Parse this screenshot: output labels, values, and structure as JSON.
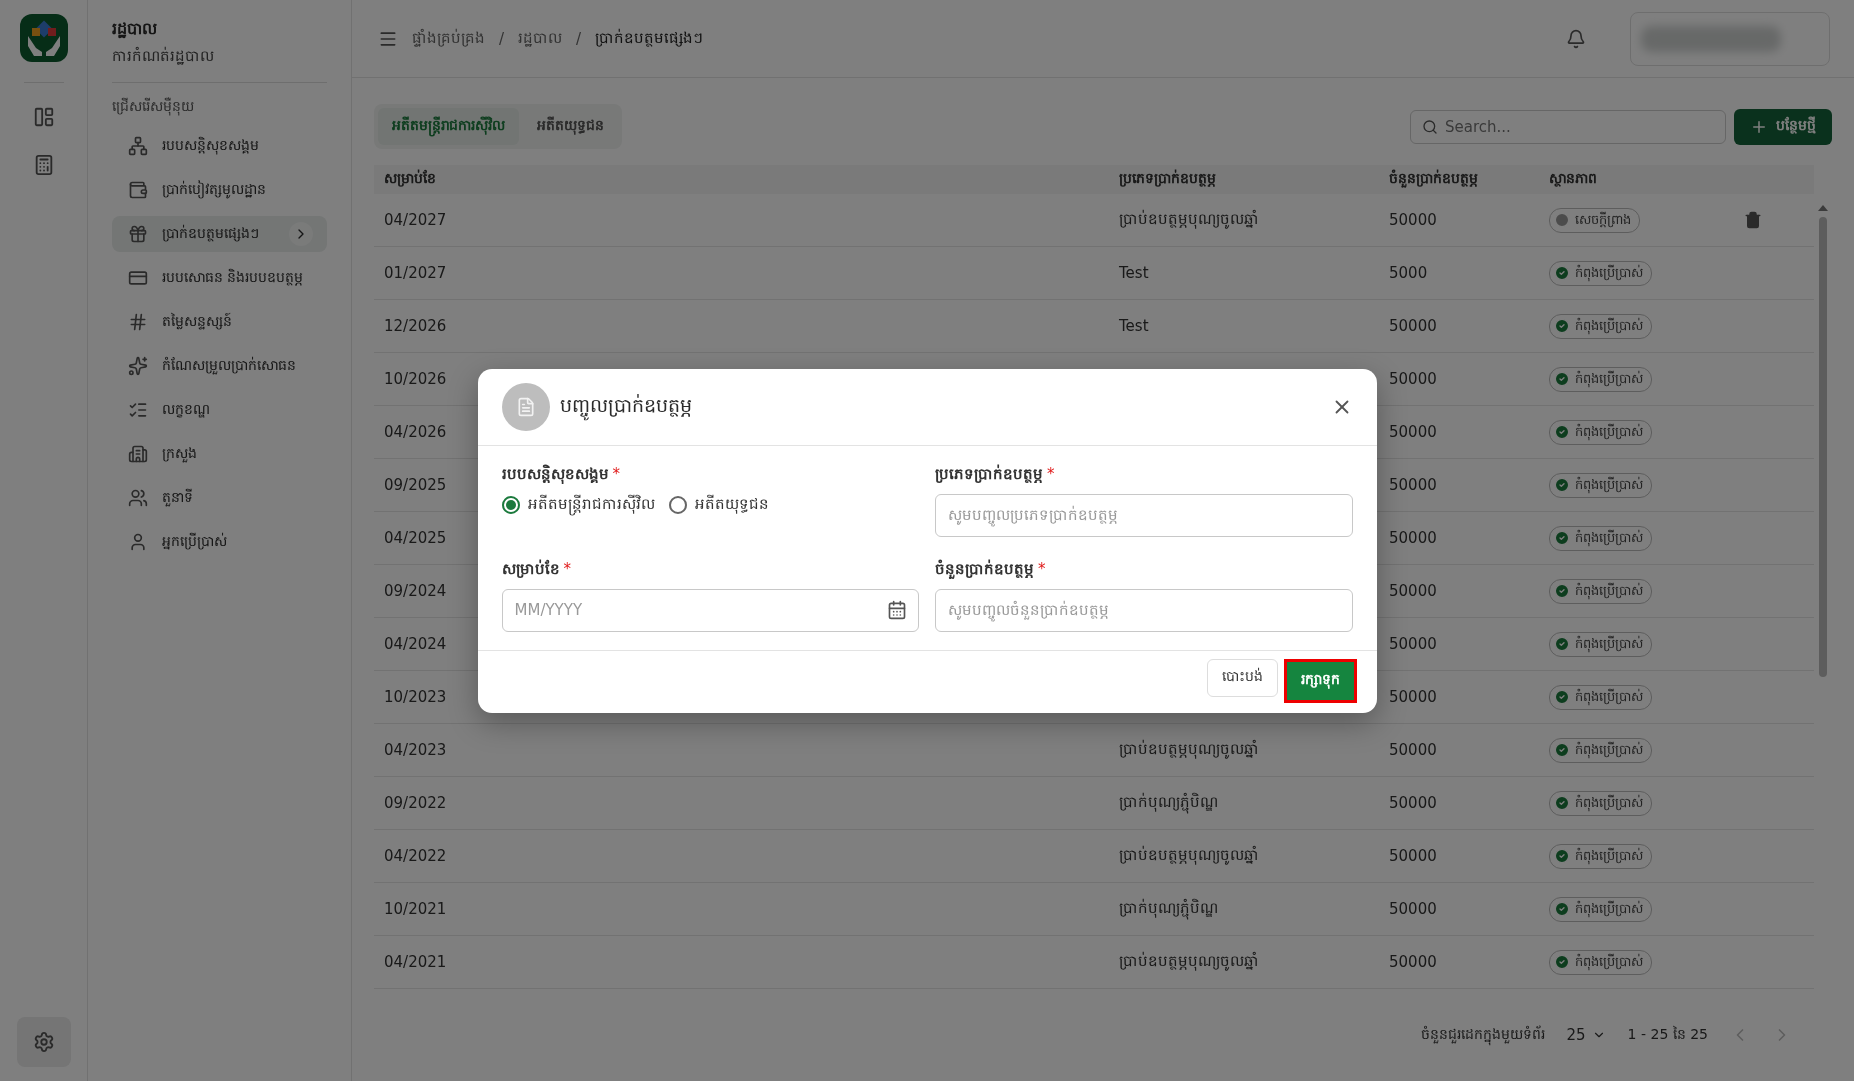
{
  "app": {
    "title": "រដ្ឋបាល",
    "subtitle": "ការកំណត់រដ្ឋបាល"
  },
  "sidebar": {
    "heading": "ជ្រើសរើសម៉ឺនុយ",
    "items": [
      {
        "label": "របបសន្តិសុខសង្គម",
        "selected": false
      },
      {
        "label": "ប្រាក់បៀវត្សមូលដ្ឋាន",
        "selected": false
      },
      {
        "label": "ប្រាក់ឧបត្ថមផ្សេងៗ",
        "selected": true
      },
      {
        "label": "របបសោធន និងរបបឧបត្ថម្ភ",
        "selected": false
      },
      {
        "label": "តម្លៃសន្ទស្សន៍",
        "selected": false
      },
      {
        "label": "កំណែសម្រួលប្រាក់សោធន",
        "selected": false
      },
      {
        "label": "លក្ខខណ្ឌ",
        "selected": false
      },
      {
        "label": "ក្រសួង",
        "selected": false
      },
      {
        "label": "តួនាទី",
        "selected": false
      },
      {
        "label": "អ្នកប្រើប្រាស់",
        "selected": false
      }
    ]
  },
  "breadcrumb": [
    {
      "label": "ផ្ទាំងគ្រប់គ្រង"
    },
    {
      "separator": "/",
      "label": "រដ្ឋបាល"
    },
    {
      "separator": "/",
      "label": "ប្រាក់ឧបត្ថមផ្សេងៗ"
    }
  ],
  "tabs": [
    {
      "label": "អតីតមន្ត្រីរាជការស៊ីវិល",
      "selected": true
    },
    {
      "label": "អតីតយុទ្ធជន",
      "selected": false
    }
  ],
  "search": {
    "placeholder": "Search..."
  },
  "add_button": "បន្ថែមថ្មី",
  "table": {
    "columns": [
      "សម្រាប់ខែ",
      "ប្រភេទប្រាក់ឧបត្ថម្ភ",
      "ចំនួនប្រាក់ឧបត្ថម្ភ",
      "ស្ថានភាព"
    ],
    "rows": [
      {
        "month": "04/2027",
        "type": "ប្រាប់ឧបត្ថម្ភបុណ្យចូលឆ្នាំ",
        "amount": "50000",
        "status": {
          "kind": "draft",
          "label": "សេចក្តីព្រាង"
        },
        "deletable": true
      },
      {
        "month": "01/2027",
        "type": "Test",
        "amount": "5000",
        "status": {
          "kind": "active",
          "label": "កំពុងប្រើប្រាស់"
        },
        "deletable": false
      },
      {
        "month": "12/2026",
        "type": "Test",
        "amount": "50000",
        "status": {
          "kind": "active",
          "label": "កំពុងប្រើប្រាស់"
        },
        "deletable": false
      },
      {
        "month": "10/2026",
        "amount": "50000",
        "status": {
          "kind": "active",
          "label": "កំពុងប្រើប្រាស់"
        },
        "deletable": false
      },
      {
        "month": "04/2026",
        "amount": "50000",
        "status": {
          "kind": "active",
          "label": "កំពុងប្រើប្រាស់"
        },
        "deletable": false
      },
      {
        "month": "09/2025",
        "amount": "50000",
        "status": {
          "kind": "active",
          "label": "កំពុងប្រើប្រាស់"
        },
        "deletable": false
      },
      {
        "month": "04/2025",
        "amount": "50000",
        "status": {
          "kind": "active",
          "label": "កំពុងប្រើប្រាស់"
        },
        "deletable": false
      },
      {
        "month": "09/2024",
        "amount": "50000",
        "status": {
          "kind": "active",
          "label": "កំពុងប្រើប្រាស់"
        },
        "deletable": false
      },
      {
        "month": "04/2024",
        "amount": "50000",
        "status": {
          "kind": "active",
          "label": "កំពុងប្រើប្រាស់"
        },
        "deletable": false
      },
      {
        "month": "10/2023",
        "amount": "50000",
        "status": {
          "kind": "active",
          "label": "កំពុងប្រើប្រាស់"
        },
        "deletable": false
      },
      {
        "month": "04/2023",
        "type": "ប្រាប់ឧបត្ថម្ភបុណ្យចូលឆ្នាំ",
        "amount": "50000",
        "status": {
          "kind": "active",
          "label": "កំពុងប្រើប្រាស់"
        },
        "deletable": false
      },
      {
        "month": "09/2022",
        "type": "ប្រាក់បុណ្យភ្ជុំបិណ្ឌ",
        "amount": "50000",
        "status": {
          "kind": "active",
          "label": "កំពុងប្រើប្រាស់"
        },
        "deletable": false
      },
      {
        "month": "04/2022",
        "type": "ប្រាប់ឧបត្ថម្ភបុណ្យចូលឆ្នាំ",
        "amount": "50000",
        "status": {
          "kind": "active",
          "label": "កំពុងប្រើប្រាស់"
        },
        "deletable": false
      },
      {
        "month": "10/2021",
        "type": "ប្រាក់បុណ្យភ្ជុំបិណ្ឌ",
        "amount": "50000",
        "status": {
          "kind": "active",
          "label": "កំពុងប្រើប្រាស់"
        },
        "deletable": false
      },
      {
        "month": "04/2021",
        "type": "ប្រាប់ឧបត្ថម្ភបុណ្យចូលឆ្នាំ",
        "amount": "50000",
        "status": {
          "kind": "active",
          "label": "កំពុងប្រើប្រាស់"
        },
        "deletable": false
      }
    ]
  },
  "pagination": {
    "rows_label": "ចំនួនជួរដេកក្នុងមួយទំព័រ",
    "rows_per_page": "25",
    "range": "1 - 25 នៃ 25"
  },
  "dialog": {
    "title": "បញ្ចូលប្រាក់ឧបត្ថម្ភ",
    "scheme": {
      "label": "របបសន្តិសុខសង្គម",
      "required_mark": "*",
      "options": [
        {
          "label": "អតីតមន្ត្រីរាជការស៊ីវិល",
          "selected": true
        },
        {
          "label": "អតីតយុទ្ធជន",
          "selected": false
        }
      ]
    },
    "type_field": {
      "label": "ប្រភេទប្រាក់ឧបត្ថម្ភ",
      "required_mark": "*",
      "placeholder": "សូមបញ្ចូលប្រភេទប្រាក់ឧបត្ថម្ភ"
    },
    "month_field": {
      "label": "សម្រាប់ខែ",
      "required_mark": "*",
      "placeholder": "MM/YYYY"
    },
    "amount_field": {
      "label": "ចំនួនប្រាក់ឧបត្ថម្ភ",
      "required_mark": "*",
      "placeholder": "សូមបញ្ចូលចំនួនប្រាក់ឧបត្ថម្ភ"
    },
    "cancel_button": "បោះបង់",
    "save_button": "រក្សាទុក"
  }
}
